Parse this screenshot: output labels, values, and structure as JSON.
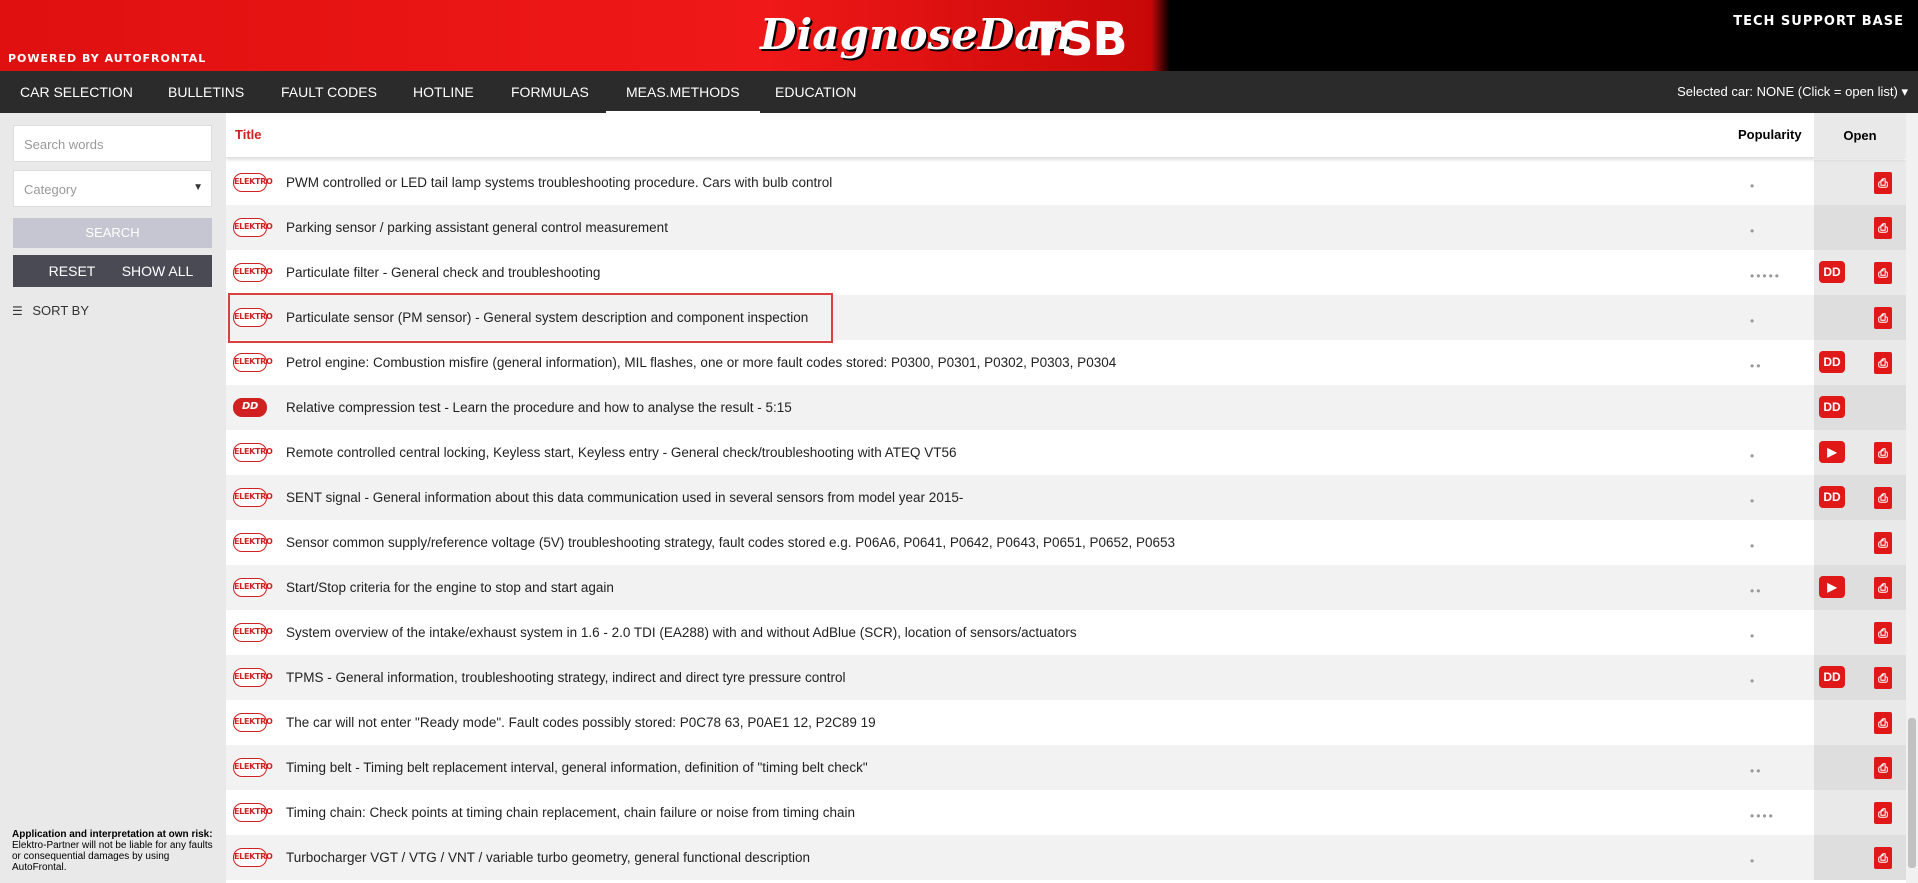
{
  "header": {
    "powered": "POWERED BY AUTOFRONTAL",
    "logo_main": "DiagnoseDan",
    "logo_tsb": "TSB",
    "subtitle": "TECH SUPPORT BASE"
  },
  "nav": {
    "tabs": [
      "CAR SELECTION",
      "BULLETINS",
      "FAULT CODES",
      "HOTLINE",
      "FORMULAS",
      "MEAS.METHODS",
      "EDUCATION"
    ],
    "active": "MEAS.METHODS",
    "selected_car": "Selected car: NONE (Click = open list) ▾"
  },
  "sidebar": {
    "search_placeholder": "Search words",
    "category_placeholder": "Category",
    "search_label": "SEARCH",
    "reset_label": "RESET",
    "show_all_label": "SHOW ALL",
    "sort_label": "SORT BY",
    "disclaimer_title": "Application and interpretation at own risk:",
    "disclaimer_text": "Elektro-Partner will not be liable for any faults or consequential damages by using AutoFrontal."
  },
  "table": {
    "col_title": "Title",
    "col_popularity": "Popularity",
    "col_open": "Open",
    "tag_labels": {
      "elektro": "ELEKTRO",
      "dd": "DD"
    },
    "icon_glyphs": {
      "pdf": "⎙",
      "video": "▶",
      "dd": "DD"
    },
    "rows": [
      {
        "tag": "elektro",
        "title": "PWM controlled or LED tail lamp systems troubleshooting procedure. Cars with bulb control",
        "popularity": "•",
        "icons": [
          "pdf"
        ]
      },
      {
        "tag": "elektro",
        "title": "Parking sensor / parking assistant general control measurement",
        "popularity": "•",
        "icons": [
          "pdf"
        ]
      },
      {
        "tag": "elektro",
        "title": "Particulate filter - General check and troubleshooting",
        "popularity": "•••••",
        "icons": [
          "dd",
          "pdf"
        ]
      },
      {
        "tag": "elektro",
        "title": "Particulate sensor (PM sensor) - General system description and component inspection",
        "popularity": "•",
        "icons": [
          "pdf"
        ]
      },
      {
        "tag": "elektro",
        "title": "Petrol engine: Combustion misfire (general information), MIL flashes, one or more fault codes stored: P0300, P0301, P0302, P0303, P0304",
        "popularity": "••",
        "icons": [
          "dd",
          "pdf"
        ]
      },
      {
        "tag": "dd",
        "title": "Relative compression test - Learn the procedure and how to analyse the result - 5:15",
        "popularity": "",
        "icons": [
          "dd"
        ]
      },
      {
        "tag": "elektro",
        "title": "Remote controlled central locking, Keyless start, Keyless entry - General check/troubleshooting with ATEQ VT56",
        "popularity": "•",
        "icons": [
          "video",
          "pdf"
        ]
      },
      {
        "tag": "elektro",
        "title": "SENT signal - General information about this data communication used in several sensors from model year 2015-",
        "popularity": "•",
        "icons": [
          "dd",
          "pdf"
        ]
      },
      {
        "tag": "elektro",
        "title": "Sensor common supply/reference voltage (5V) troubleshooting strategy, fault codes stored e.g. P06A6, P0641, P0642, P0643, P0651, P0652, P0653",
        "popularity": "•",
        "icons": [
          "pdf"
        ]
      },
      {
        "tag": "elektro",
        "title": "Start/Stop criteria for the engine to stop and start again",
        "popularity": "••",
        "icons": [
          "video",
          "pdf"
        ]
      },
      {
        "tag": "elektro",
        "title": "System overview of the intake/exhaust system in 1.6 - 2.0 TDI (EA288) with and without AdBlue (SCR), location of sensors/actuators",
        "popularity": "•",
        "icons": [
          "pdf"
        ]
      },
      {
        "tag": "elektro",
        "title": "TPMS - General information, troubleshooting strategy, indirect and direct tyre pressure control",
        "popularity": "•",
        "icons": [
          "dd",
          "pdf"
        ]
      },
      {
        "tag": "elektro",
        "title": "The car will not enter \"Ready mode\". Fault codes possibly stored: P0C78 63, P0AE1 12, P2C89 19",
        "popularity": "",
        "icons": [
          "pdf"
        ]
      },
      {
        "tag": "elektro",
        "title": "Timing belt - Timing belt replacement interval, general information, definition of \"timing belt check\"",
        "popularity": "••",
        "icons": [
          "pdf"
        ]
      },
      {
        "tag": "elektro",
        "title": "Timing chain: Check points at timing chain replacement, chain failure or noise from timing chain",
        "popularity": "••••",
        "icons": [
          "pdf"
        ]
      },
      {
        "tag": "elektro",
        "title": "Turbocharger VGT / VTG / VNT / variable turbo geometry, general functional description",
        "popularity": "•",
        "icons": [
          "pdf"
        ]
      }
    ]
  }
}
